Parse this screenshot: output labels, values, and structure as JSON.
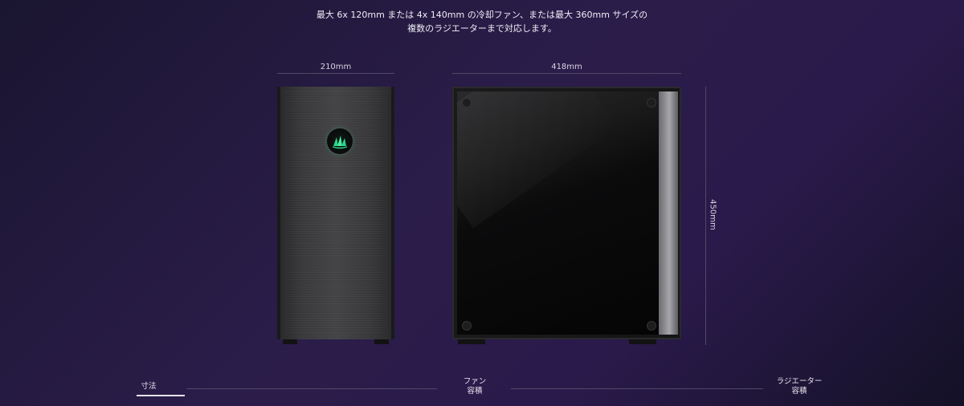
{
  "description": {
    "line1": "最大 6x 120mm または 4x 140mm の冷却ファン、または最大 360mm サイズの",
    "line2": "複数のラジエーターまで対応します。"
  },
  "dimensions": {
    "width": "210mm",
    "depth": "418mm",
    "height": "450mm"
  },
  "tabs": [
    {
      "label": "寸法",
      "active": true
    },
    {
      "label": "ファン\n容積",
      "active": false
    },
    {
      "label": "ラジエーター\n容積",
      "active": false
    }
  ],
  "colors": {
    "background_start": "#1a1530",
    "background_mid": "#2b1d4a",
    "logo_glow": "#3cff96"
  },
  "icons": {
    "logo": "corsair-sails-icon"
  }
}
